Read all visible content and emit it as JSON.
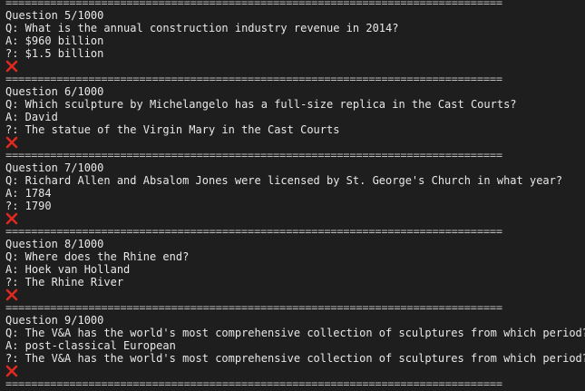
{
  "separator": "==============================================================================",
  "entries": [
    {
      "header": "Question 5/1000",
      "question": "Q: What is the annual construction industry revenue in 2014?",
      "answer": "A: $960 billion",
      "guess": "?: $1.5 billion",
      "result_icon": "red-cross-mark"
    },
    {
      "header": "Question 6/1000",
      "question": "Q: Which sculpture by Michelangelo has a full-size replica in the Cast Courts?",
      "answer": "A: David",
      "guess": "?: The statue of the Virgin Mary in the Cast Courts",
      "result_icon": "red-cross-mark"
    },
    {
      "header": "Question 7/1000",
      "question": "Q: Richard Allen and Absalom Jones were licensed by St. George's Church in what year?",
      "answer": "A: 1784",
      "guess": "?: 1790",
      "result_icon": "red-cross-mark"
    },
    {
      "header": "Question 8/1000",
      "question": "Q: Where does the Rhine end?",
      "answer": "A: Hoek van Holland",
      "guess": "?: The Rhine River",
      "result_icon": "red-cross-mark"
    },
    {
      "header": "Question 9/1000",
      "question": "Q: The V&A has the world's most comprehensive collection of sculptures from which period?",
      "answer": "A: post-classical European",
      "guess": "?: The V&A has the world's most comprehensive collection of sculptures from which period?",
      "result_icon": "red-cross-mark"
    }
  ],
  "colors": {
    "background": "#1e1e1e",
    "text": "#e8e8e8",
    "cross": "#e0291f"
  }
}
